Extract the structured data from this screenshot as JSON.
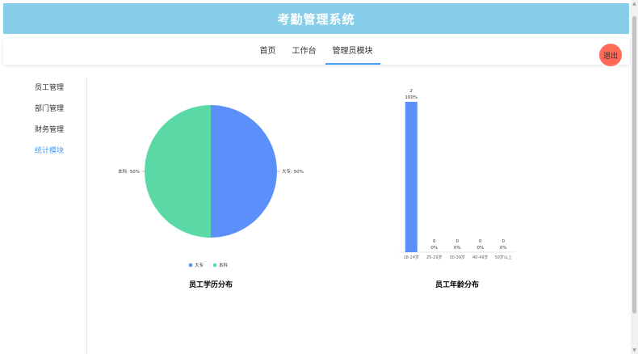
{
  "header": {
    "title": "考勤管理系统"
  },
  "nav": {
    "tabs": [
      {
        "label": "首页"
      },
      {
        "label": "工作台"
      },
      {
        "label": "管理员模块"
      }
    ],
    "logout_label": "退出"
  },
  "sidebar": {
    "items": [
      {
        "label": "员工管理"
      },
      {
        "label": "部门管理"
      },
      {
        "label": "财务管理"
      },
      {
        "label": "统计模块"
      }
    ]
  },
  "colors": {
    "header_bg": "#87ceeb",
    "accent": "#409eff",
    "logout": "#ff6b57",
    "series_blue": "#5b8ff9",
    "series_green": "#5ad8a6"
  },
  "chart_data": [
    {
      "type": "pie",
      "title": "员工学历分布",
      "categories": [
        "大专",
        "本科"
      ],
      "values": [
        50,
        50
      ],
      "slice_labels": [
        "大专: 50%",
        "本科: 50%"
      ],
      "legend": [
        "大专",
        "本科"
      ],
      "legend_position": "bottom"
    },
    {
      "type": "bar",
      "title": "员工年龄分布",
      "categories": [
        "18-24岁",
        "25-29岁",
        "30-39岁",
        "40-49岁",
        "50岁以上"
      ],
      "values": [
        2,
        0,
        0,
        0,
        0
      ],
      "percent_labels": [
        "100%",
        "0%",
        "0%",
        "0%",
        "0%"
      ],
      "ylim": [
        0,
        2
      ]
    }
  ]
}
